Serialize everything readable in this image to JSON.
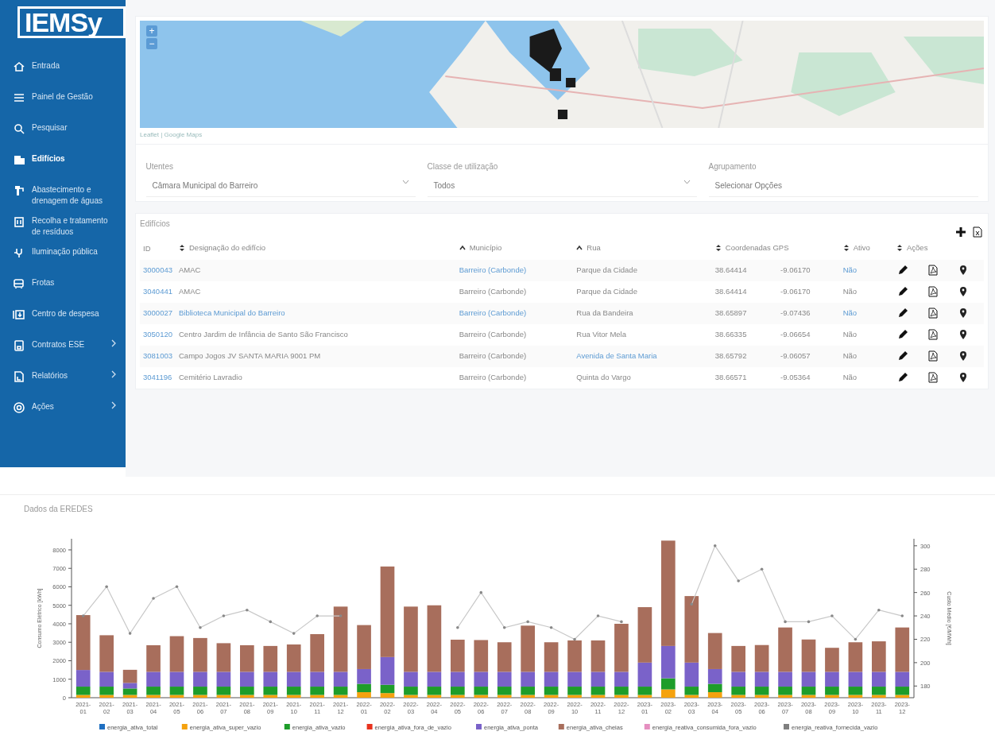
{
  "sidebar": {
    "logo": "IEMSy",
    "items": [
      {
        "label": "Entrada",
        "selected": false,
        "submenu": false
      },
      {
        "label": "Painel de Gestão",
        "selected": false,
        "submenu": false
      },
      {
        "label": "Pesquisar",
        "selected": false,
        "submenu": false
      },
      {
        "label": "Edifícios",
        "selected": true,
        "submenu": false
      },
      {
        "label": "Abastecimento e drenagem de águas",
        "selected": false,
        "submenu": false
      },
      {
        "label": "Recolha e tratamento de resíduos",
        "selected": false,
        "submenu": false
      },
      {
        "label": "Iluminação pública",
        "selected": false,
        "submenu": false
      },
      {
        "label": "Frotas",
        "selected": false,
        "submenu": false
      },
      {
        "label": "Centro de despesa",
        "selected": false,
        "submenu": false
      },
      {
        "label": "Contratos ESE",
        "selected": false,
        "submenu": true
      },
      {
        "label": "Relatórios",
        "selected": false,
        "submenu": true
      },
      {
        "label": "Ações",
        "selected": false,
        "submenu": true
      }
    ]
  },
  "map": {
    "zoom_in": "+",
    "zoom_out": "−",
    "attribution": "Leaflet | Google Maps"
  },
  "filters": [
    {
      "label": "Utentes",
      "value": "Câmara Municipal do Barreiro",
      "kind": "select"
    },
    {
      "label": "Classe de utilização",
      "value": "Todos",
      "kind": "select"
    },
    {
      "label": "Agrupamento",
      "value": "Selecionar Opções",
      "kind": "text"
    }
  ],
  "table": {
    "title": "Edifícios",
    "columns": [
      {
        "label": "ID",
        "sortable": false
      },
      {
        "label": "Designação do edifício",
        "sortable": true,
        "sorted": false
      },
      {
        "label": "Município",
        "sortable": true,
        "sorted": true
      },
      {
        "label": "Rua",
        "sortable": true,
        "sorted": true
      },
      {
        "label": "Coordenadas GPS",
        "sortable": true,
        "sorted": false
      },
      {
        "label": "Ativo",
        "sortable": true,
        "sorted": false
      },
      {
        "label": "Ações",
        "sortable": true,
        "sorted": false
      }
    ],
    "rows": [
      {
        "id": "3000043",
        "name": "AMAC",
        "name_link": false,
        "municipality": "Barreiro (Carbonde)",
        "municipality_link": true,
        "street": "Parque da Cidade",
        "street_link": false,
        "lat": "38.64414",
        "lon": "-9.06170",
        "active": "Não",
        "active_link": true
      },
      {
        "id": "3040441",
        "name": "AMAC",
        "name_link": false,
        "municipality": "Barreiro (Carbonde)",
        "municipality_link": false,
        "street": "Parque da Cidade",
        "street_link": false,
        "lat": "38.64414",
        "lon": "-9.06170",
        "active": "Não",
        "active_link": false
      },
      {
        "id": "3000027",
        "name": "Biblioteca Municipal do Barreiro",
        "name_link": true,
        "municipality": "Barreiro (Carbonde)",
        "municipality_link": true,
        "street": "Rua da Bandeira",
        "street_link": false,
        "lat": "38.65897",
        "lon": "-9.07436",
        "active": "Não",
        "active_link": true
      },
      {
        "id": "3050120",
        "name": "Centro Jardim de Infância de Santo São Francisco",
        "name_link": false,
        "municipality": "Barreiro (Carbonde)",
        "municipality_link": false,
        "street": "Rua Vitor Mela",
        "street_link": false,
        "lat": "38.66335",
        "lon": "-9.06654",
        "active": "Não",
        "active_link": false
      },
      {
        "id": "3081003",
        "name": "Campo Jogos JV SANTA MARIA 9001 PM",
        "name_link": false,
        "municipality": "Barreiro (Carbonde)",
        "municipality_link": false,
        "street": "Avenida de Santa Maria",
        "street_link": true,
        "lat": "38.65792",
        "lon": "-9.06057",
        "active": "Não",
        "active_link": false
      },
      {
        "id": "3041196",
        "name": "Cemitério Lavradio",
        "name_link": false,
        "municipality": "Barreiro (Carbonde)",
        "municipality_link": false,
        "street": "Quinta do Vargo",
        "street_link": false,
        "lat": "38.66571",
        "lon": "-9.05364",
        "active": "Não",
        "active_link": false
      }
    ]
  },
  "chart": {
    "title": "Dados da EREDES",
    "chart_data": {
      "type": "bar",
      "stacked": true,
      "legend": "bottom",
      "ylabel": "Consumo Elétrico [kWh]",
      "y2label": "Custo Médio [€/MWh]",
      "categories": [
        "2021-01",
        "2021-02",
        "2021-03",
        "2021-04",
        "2021-05",
        "2021-06",
        "2021-07",
        "2021-08",
        "2021-09",
        "2021-10",
        "2021-11",
        "2021-12",
        "2022-01",
        "2022-02",
        "2022-03",
        "2022-04",
        "2022-05",
        "2022-06",
        "2022-07",
        "2022-08",
        "2022-09",
        "2022-10",
        "2022-11",
        "2022-12",
        "2023-01",
        "2023-02",
        "2023-03",
        "2023-04",
        "2023-05",
        "2023-06",
        "2023-07",
        "2023-08",
        "2023-09",
        "2023-10",
        "2023-11",
        "2023-12"
      ],
      "ylim": [
        0,
        8600
      ],
      "yticks": [
        0,
        1000,
        2000,
        3000,
        4000,
        5000,
        6000,
        7000,
        8000
      ],
      "y2lim": [
        170,
        306
      ],
      "y2ticks": [
        180,
        200,
        220,
        240,
        260,
        280,
        300
      ],
      "series": [
        {
          "name": "energia_ativa_total",
          "color": "#1f6fc1",
          "values": [
            0,
            0,
            0,
            0,
            0,
            0,
            0,
            0,
            0,
            0,
            0,
            0,
            0,
            0,
            0,
            0,
            0,
            0,
            0,
            0,
            0,
            0,
            0,
            0,
            0,
            0,
            0,
            0,
            0,
            0,
            0,
            0,
            0,
            0,
            0,
            0
          ]
        },
        {
          "name": "energia_ativa_super_vazio",
          "color": "#f5a20f",
          "values": [
            150,
            150,
            150,
            150,
            150,
            150,
            150,
            150,
            150,
            150,
            150,
            150,
            300,
            250,
            150,
            150,
            150,
            150,
            150,
            150,
            150,
            150,
            150,
            150,
            150,
            450,
            150,
            300,
            150,
            150,
            150,
            150,
            150,
            150,
            150,
            150
          ]
        },
        {
          "name": "energia_ativa_vazio",
          "color": "#1e9d2a",
          "values": [
            450,
            450,
            350,
            450,
            450,
            450,
            450,
            450,
            450,
            450,
            450,
            450,
            450,
            450,
            450,
            450,
            450,
            450,
            450,
            450,
            450,
            450,
            450,
            450,
            450,
            600,
            450,
            450,
            450,
            450,
            450,
            450,
            450,
            450,
            450,
            450
          ]
        },
        {
          "name": "energia_ativa_fora_de_vazio",
          "color": "#e8321e",
          "values": [
            0,
            0,
            0,
            0,
            0,
            0,
            0,
            0,
            0,
            0,
            0,
            0,
            0,
            0,
            0,
            0,
            0,
            0,
            0,
            0,
            0,
            0,
            0,
            0,
            0,
            0,
            0,
            0,
            0,
            0,
            0,
            0,
            0,
            0,
            0,
            0
          ]
        },
        {
          "name": "energia_ativa_ponta",
          "color": "#7a62c9",
          "values": [
            900,
            800,
            300,
            800,
            800,
            800,
            800,
            800,
            800,
            800,
            800,
            800,
            800,
            1500,
            800,
            800,
            800,
            800,
            800,
            800,
            800,
            800,
            800,
            800,
            1300,
            1750,
            1300,
            800,
            800,
            800,
            800,
            800,
            800,
            800,
            800,
            800
          ]
        },
        {
          "name": "energia_ativa_cheias",
          "color": "#a86e5c",
          "values": [
            2970,
            1980,
            710,
            1440,
            1930,
            1830,
            1550,
            1440,
            1400,
            1480,
            2040,
            3530,
            2380,
            4900,
            3530,
            3600,
            1740,
            1720,
            1600,
            2500,
            1600,
            1700,
            1700,
            2600,
            3000,
            5700,
            3600,
            1950,
            1400,
            1450,
            2400,
            1750,
            1300,
            1600,
            1650,
            2400
          ]
        },
        {
          "name": "energia_reativa_consumida_fora_vazio",
          "color": "#e58fc0",
          "values": [
            0,
            0,
            0,
            0,
            0,
            0,
            0,
            0,
            0,
            0,
            0,
            0,
            0,
            0,
            0,
            0,
            0,
            0,
            0,
            0,
            0,
            0,
            0,
            0,
            0,
            0,
            0,
            0,
            0,
            0,
            0,
            0,
            0,
            0,
            0,
            0
          ]
        },
        {
          "name": "energia_reativa_fornecida_vazio",
          "color": "#7f7f7f",
          "values": [
            0,
            0,
            0,
            0,
            0,
            0,
            0,
            0,
            0,
            0,
            0,
            0,
            0,
            0,
            0,
            0,
            0,
            0,
            0,
            0,
            0,
            0,
            0,
            0,
            0,
            0,
            0,
            0,
            0,
            0,
            0,
            0,
            0,
            0,
            0,
            0
          ]
        },
        {
          "type": "line",
          "axis": "y2",
          "color": "#c8c8c8",
          "values": [
            240,
            265,
            225,
            255,
            265,
            230,
            240,
            245,
            235,
            225,
            240,
            240,
            null,
            null,
            null,
            null,
            230,
            260,
            230,
            235,
            230,
            220,
            240,
            235,
            null,
            null,
            250,
            300,
            270,
            280,
            235,
            235,
            240,
            220,
            245,
            240
          ]
        }
      ]
    }
  }
}
